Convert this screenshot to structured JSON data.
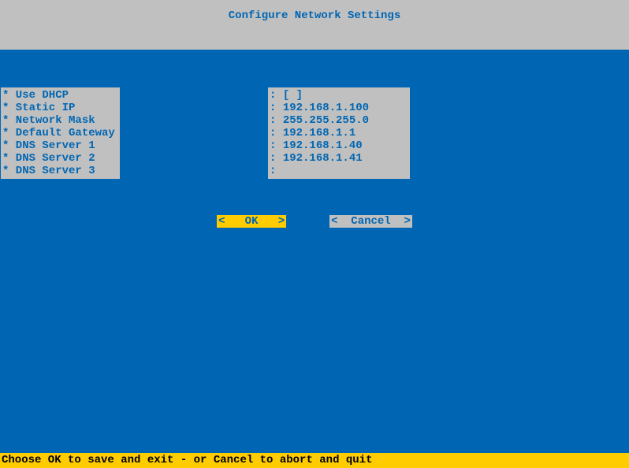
{
  "header": {
    "title": "Configure Network Settings"
  },
  "fields": [
    {
      "label": "* Use DHCP",
      "value": "[ ]"
    },
    {
      "label": "* Static IP",
      "value": "192.168.1.100"
    },
    {
      "label": "* Network Mask",
      "value": "255.255.255.0"
    },
    {
      "label": "* Default Gateway",
      "value": "192.168.1.1"
    },
    {
      "label": "* DNS Server 1",
      "value": "192.168.1.40"
    },
    {
      "label": "* DNS Server 2",
      "value": "192.168.1.41"
    },
    {
      "label": "* DNS Server 3",
      "value": ""
    }
  ],
  "buttons": {
    "ok": "<   OK   >",
    "cancel": "<  Cancel  >"
  },
  "footer": {
    "text": "Choose OK to save and exit - or Cancel to abort and quit"
  }
}
